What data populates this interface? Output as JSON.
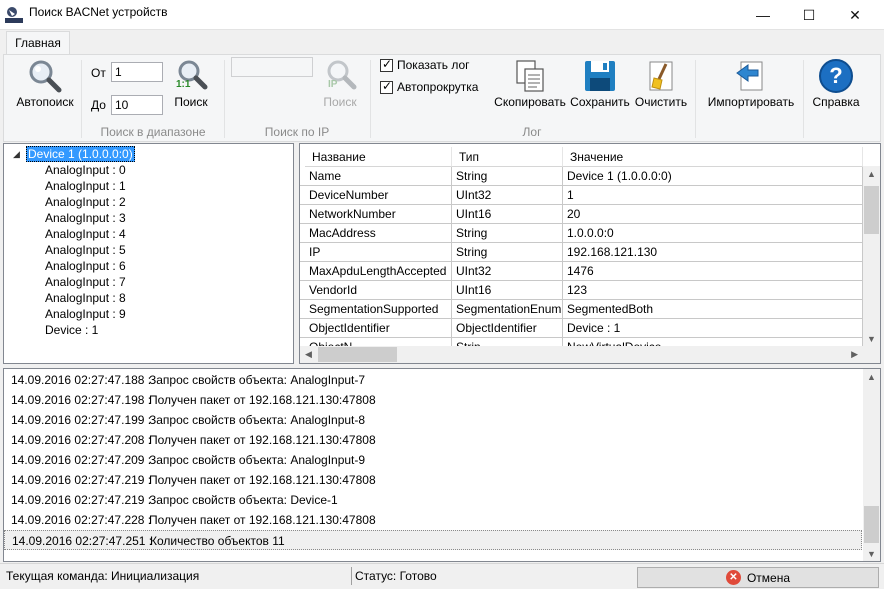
{
  "window": {
    "title": "Поиск BACNet устройств",
    "minimize_glyph": "—",
    "maximize_glyph": "☐",
    "close_glyph": "✕"
  },
  "ribbon": {
    "tab_label": "Главная",
    "autosearch": {
      "label": "Автопоиск",
      "icon": "magnifier-icon"
    },
    "range": {
      "from_label": "От",
      "from_value": "1",
      "to_label": "До",
      "to_value": "10",
      "search_label": "Поиск",
      "ratio_label": "1:1",
      "group_label": "Поиск в диапазоне"
    },
    "ip": {
      "value": "",
      "search_label": "Поиск",
      "ip_badge": "IP",
      "group_label": "Поиск по IP"
    },
    "log": {
      "show_log_label": "Показать лог",
      "show_log_checked": true,
      "autoscroll_label": "Автопрокрутка",
      "autoscroll_checked": true,
      "copy_label": "Скопировать",
      "save_label": "Сохранить",
      "clear_label": "Очистить",
      "group_label": "Лог"
    },
    "import_label": "Импортировать",
    "help_label": "Справка",
    "help_glyph": "?"
  },
  "tree": {
    "root": "Device 1 (1.0.0.0:0)",
    "children": [
      "AnalogInput : 0",
      "AnalogInput : 1",
      "AnalogInput : 2",
      "AnalogInput : 3",
      "AnalogInput : 4",
      "AnalogInput : 5",
      "AnalogInput : 6",
      "AnalogInput : 7",
      "AnalogInput : 8",
      "AnalogInput : 9",
      "Device : 1"
    ]
  },
  "grid": {
    "columns": [
      "Название",
      "Тип",
      "Значение"
    ],
    "rows": [
      [
        "Name",
        "String",
        "Device 1 (1.0.0.0:0)"
      ],
      [
        "DeviceNumber",
        "UInt32",
        "1"
      ],
      [
        "NetworkNumber",
        "UInt16",
        "20"
      ],
      [
        "MacAddress",
        "String",
        "1.0.0.0:0"
      ],
      [
        "IP",
        "String",
        "192.168.121.130"
      ],
      [
        "MaxApduLengthAccepted",
        "UInt32",
        "1476"
      ],
      [
        "VendorId",
        "UInt16",
        "123"
      ],
      [
        "SegmentationSupported",
        "SegmentationEnum",
        "SegmentedBoth"
      ],
      [
        "ObjectIdentifier",
        "ObjectIdentifier",
        "Device : 1"
      ],
      [
        "ObjectN",
        "Strin",
        "NewVirtualDevice"
      ]
    ]
  },
  "log": {
    "lines": [
      {
        "time": "14.09.2016 02:27:47.188 :",
        "text": "Запрос свойств объекта: AnalogInput-7"
      },
      {
        "time": "14.09.2016 02:27:47.198 :",
        "text": "Получен пакет от 192.168.121.130:47808"
      },
      {
        "time": "14.09.2016 02:27:47.199 :",
        "text": "Запрос свойств объекта: AnalogInput-8"
      },
      {
        "time": "14.09.2016 02:27:47.208 :",
        "text": "Получен пакет от 192.168.121.130:47808"
      },
      {
        "time": "14.09.2016 02:27:47.209 :",
        "text": "Запрос свойств объекта: AnalogInput-9"
      },
      {
        "time": "14.09.2016 02:27:47.219 :",
        "text": "Получен пакет от 192.168.121.130:47808"
      },
      {
        "time": "14.09.2016 02:27:47.219 :",
        "text": "Запрос свойств объекта: Device-1"
      },
      {
        "time": "14.09.2016 02:27:47.228 :",
        "text": "Получен пакет от 192.168.121.130:47808"
      },
      {
        "time": "14.09.2016 02:27:47.251 :",
        "text": "Количество объектов 11"
      }
    ]
  },
  "status": {
    "current_command": "Текущая команда: Инициализация",
    "state": "Статус: Готово",
    "cancel_label": "Отмена",
    "cancel_glyph": "✕"
  }
}
